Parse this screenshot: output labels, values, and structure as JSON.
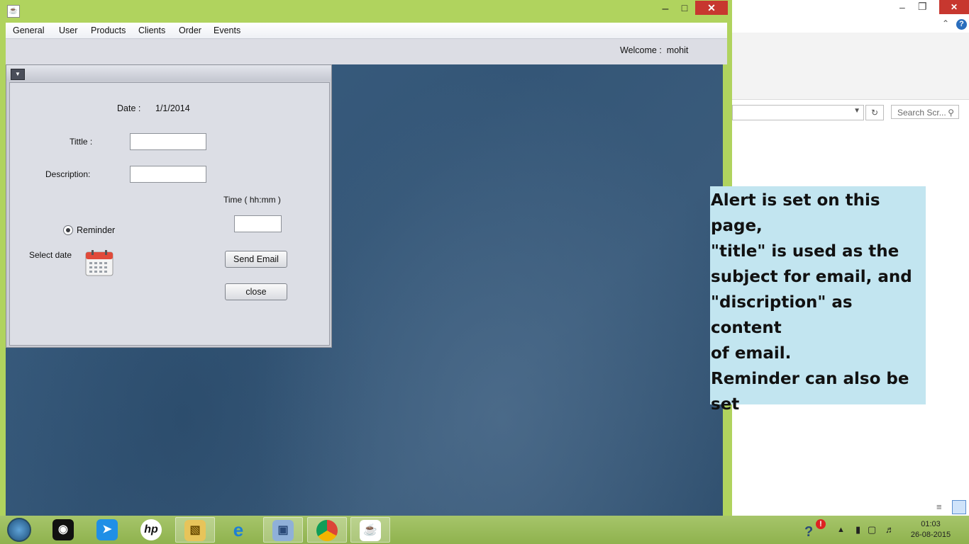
{
  "app": {
    "menu": [
      "General",
      "User",
      "Products",
      "Clients",
      "Order",
      "Events"
    ],
    "welcome_label": "Welcome :",
    "username": "mohit"
  },
  "form": {
    "date_label": "Date :",
    "date_value": "1/1/2014",
    "title_label": "Tittle :",
    "title_value": "",
    "description_label": "Description:",
    "description_value": "",
    "time_label": "Time ( hh:mm )",
    "time_value": "",
    "reminder_label": "Reminder",
    "select_date_label": "Select date",
    "send_email_label": "Send Email",
    "close_label": "close"
  },
  "explorer": {
    "search_placeholder": "Search Scr..."
  },
  "note": {
    "text": "Alert is set on this page,\n\"title\" is used as the\nsubject for email, and\n\"discription\" as content\nof email.\nReminder can also be\nset"
  },
  "taskbar": {
    "items": [
      "start-orb",
      "webcam-app",
      "rocket-app",
      "hp-app",
      "file-explorer",
      "internet-explorer",
      "virtualbox",
      "chrome",
      "java"
    ],
    "clock_time": "01:03",
    "clock_date": "26-08-2015"
  },
  "colors": {
    "accent_green": "#b0d35e",
    "desktop_blue": "#3b5f82",
    "note_bg": "#c2e5f0",
    "close_red": "#c7372f"
  }
}
